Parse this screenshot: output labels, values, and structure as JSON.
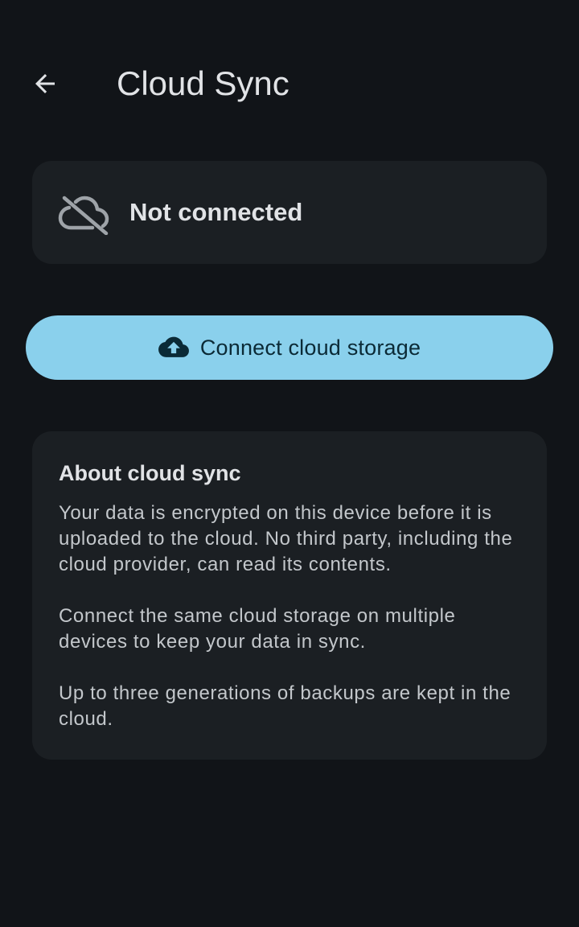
{
  "header": {
    "title": "Cloud Sync",
    "back_icon": "arrow-left-icon"
  },
  "status": {
    "icon": "cloud-off-icon",
    "text": "Not connected"
  },
  "connect_button": {
    "icon": "cloud-upload-icon",
    "label": "Connect cloud storage"
  },
  "about": {
    "title": "About cloud sync",
    "paragraphs": [
      "Your data is encrypted on this device before it is uploaded to the cloud. No third party, including the cloud provider, can read its contents.",
      "Connect the same cloud storage on multiple devices to keep your data in sync.",
      "Up to three generations of backups are kept in the cloud."
    ]
  },
  "colors": {
    "background": "#111418",
    "card": "#1b1f23",
    "accent_button": "#8ad0ec",
    "accent_button_text": "#0b2a36"
  }
}
